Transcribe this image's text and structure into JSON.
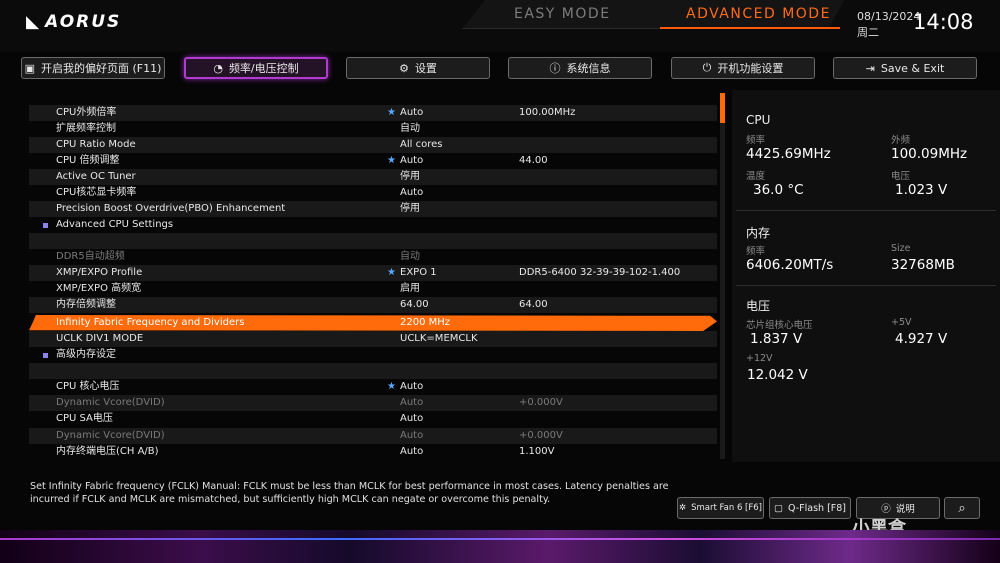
{
  "brand": "AORUS",
  "modes": {
    "easy": "EASY MODE",
    "advanced": "ADVANCED MODE"
  },
  "datetime": {
    "date": "08/13/2024",
    "weekday": "周二",
    "time": "14:08"
  },
  "tabs": [
    {
      "label": "开启我的偏好页面 (F11)",
      "icon": "page-star-icon"
    },
    {
      "label": "频率/电压控制",
      "icon": "speedometer-icon"
    },
    {
      "label": "设置",
      "icon": "gear-icon"
    },
    {
      "label": "系统信息",
      "icon": "info-icon"
    },
    {
      "label": "开机功能设置",
      "icon": "power-icon"
    },
    {
      "label": "Save & Exit",
      "icon": "exit-icon"
    }
  ],
  "settings": [
    {
      "label": "CPU外频倍率",
      "star": true,
      "v1": "Auto",
      "v2": "100.00MHz"
    },
    {
      "label": "扩展频率控制",
      "star": false,
      "v1": "自动",
      "v2": ""
    },
    {
      "label": "CPU Ratio Mode",
      "star": false,
      "v1": "All cores",
      "v2": ""
    },
    {
      "label": "CPU 倍频调整",
      "star": true,
      "v1": "Auto",
      "v2": "44.00"
    },
    {
      "label": "Active OC Tuner",
      "star": false,
      "v1": "停用",
      "v2": ""
    },
    {
      "label": "CPU核芯显卡频率",
      "star": false,
      "v1": "Auto",
      "v2": ""
    },
    {
      "label": "Precision Boost Overdrive(PBO) Enhancement",
      "star": false,
      "v1": "停用",
      "v2": ""
    },
    {
      "label": "Advanced CPU Settings",
      "submenu": true,
      "v1": "",
      "v2": ""
    },
    {
      "label": "",
      "v1": "",
      "v2": ""
    },
    {
      "label": "DDR5自动超频",
      "dim": true,
      "v1": "自动",
      "v2": ""
    },
    {
      "label": "XMP/EXPO Profile",
      "star": true,
      "v1": "EXPO 1",
      "v2": "DDR5-6400 32-39-39-102-1.400"
    },
    {
      "label": "XMP/EXPO 高频宽",
      "star": false,
      "v1": "启用",
      "v2": ""
    },
    {
      "label": "内存倍频调整",
      "star": false,
      "v1": "64.00",
      "v2": "64.00"
    },
    {
      "label": "Infinity Fabric Frequency and Dividers",
      "highlight": true,
      "v1": "2200 MHz",
      "v2": ""
    },
    {
      "label": "UCLK DIV1 MODE",
      "star": false,
      "v1": "UCLK=MEMCLK",
      "v2": ""
    },
    {
      "label": "高级内存设定",
      "submenu": true,
      "v1": "",
      "v2": ""
    },
    {
      "label": "",
      "v1": "",
      "v2": ""
    },
    {
      "label": "CPU 核心电压",
      "star": true,
      "v1": "Auto",
      "v2": ""
    },
    {
      "label": "Dynamic Vcore(DVID)",
      "dim": true,
      "v1": "Auto",
      "v2": "+0.000V"
    },
    {
      "label": "CPU SA电压",
      "star": false,
      "v1": "Auto",
      "v2": ""
    },
    {
      "label": "Dynamic Vcore(DVID)",
      "dim": true,
      "v1": "Auto",
      "v2": "+0.000V"
    },
    {
      "label": "内存终端电压(CH A/B)",
      "star": false,
      "v1": "Auto",
      "v2": "1.100V"
    }
  ],
  "monitor": {
    "cpu": {
      "title": "CPU",
      "freq_label": "频率",
      "freq": "4425.69MHz",
      "bclk_label": "外频",
      "bclk": "100.09MHz",
      "temp_label": "温度",
      "temp": "36.0 °C",
      "volt_label": "电压",
      "volt": "1.023 V"
    },
    "mem": {
      "title": "内存",
      "freq_label": "频率",
      "freq": "6406.20MT/s",
      "size_label": "Size",
      "size": "32768MB"
    },
    "volt": {
      "title": "电压",
      "chipset_label": "芯片组核心电压",
      "chipset": "1.837 V",
      "p5_label": "+5V",
      "p5": "4.927 V",
      "p12_label": "+12V",
      "p12": "12.042 V"
    }
  },
  "help_text": "Set Infinity Fabric frequency (FCLK) Manual: FCLK must be less than MCLK for best performance in most cases. Latency penalties are incurred if FCLK and MCLK are mismatched, but sufficiently high MCLK can negate or overcome this penalty.",
  "bottom_buttons": {
    "smartfan": "Smart Fan 6 [F6]",
    "qflash": "Q-Flash [F8]",
    "help": "说明"
  },
  "watermark": "小黑盒",
  "colors": {
    "accent": "#ff6a0a",
    "tab_active": "#b13bd1",
    "star": "#5aa7ff"
  }
}
